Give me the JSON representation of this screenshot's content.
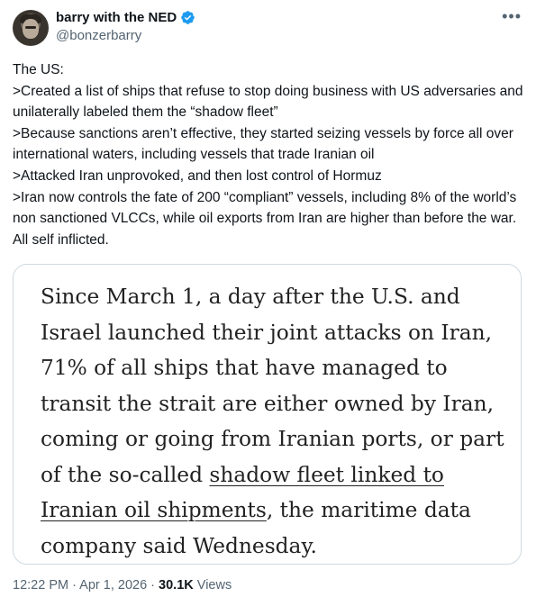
{
  "author": {
    "display_name": "barry with the NED",
    "handle": "@bonzerbarry",
    "verified_color": "#1d9bf0"
  },
  "menu_icon": "more-horizontal-icon",
  "tweet": {
    "text": "The US:\n>Created a list of ships that refuse to stop doing business with US adversaries and unilaterally labeled them the “shadow fleet”\n>Because sanctions aren’t effective, they started seizing vessels by force all over international waters, including vessels that trade Iranian oil\n>Attacked Iran unprovoked, and then lost control of Hormuz\n>Iran now controls the fate of 200 “compliant” vessels, including 8% of the world’s non sanctioned VLCCs, while oil exports from Iran are higher than before the war. All self inflicted."
  },
  "quote": {
    "text_before": "Since March 1, a day after the U.S. and Israel launched their joint attacks on Iran, 71% of all ships that have managed to transit the strait are either owned by Iran, coming or going from Iranian ports, or part of the so-called ",
    "link_text": "shadow fleet linked to Iranian oil shipments",
    "text_after": ", the maritime data company said Wednesday."
  },
  "meta": {
    "time": "12:22 PM",
    "sep1": " · ",
    "date": "Apr 1, 2026",
    "sep2": " · ",
    "views_count": "30.1K",
    "views_label": " Views"
  }
}
